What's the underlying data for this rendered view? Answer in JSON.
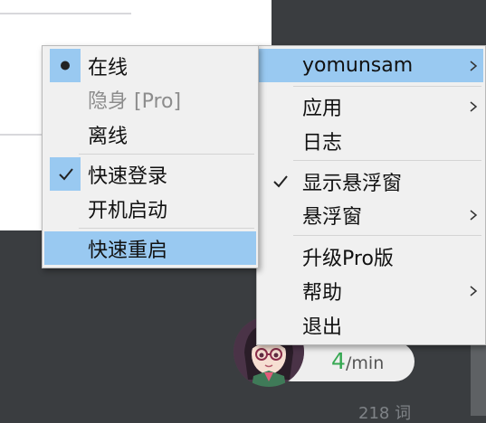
{
  "left_menu": {
    "items": [
      {
        "label": "在线",
        "mark": "bullet"
      },
      {
        "label": "隐身 [Pro]",
        "disabled": true
      },
      {
        "label": "离线"
      },
      {
        "label": "快速登录",
        "mark": "check"
      },
      {
        "label": "开机启动"
      },
      {
        "label": "快速重启",
        "highlighted": true
      }
    ]
  },
  "right_menu": {
    "items": [
      {
        "label": "yomunsam",
        "submenu": true,
        "highlighted": true
      },
      {
        "label": "应用",
        "submenu": true
      },
      {
        "label": "日志"
      },
      {
        "label": "显示悬浮窗",
        "mark": "check"
      },
      {
        "label": "悬浮窗",
        "submenu": true
      },
      {
        "label": "升级Pro版"
      },
      {
        "label": "帮助",
        "submenu": true
      },
      {
        "label": "退出"
      }
    ]
  },
  "widget": {
    "speed_value": "4",
    "speed_unit": "/min"
  },
  "background": {
    "partial_text": "218 词"
  },
  "colors": {
    "highlight": "#99c9f1",
    "menu_bg": "#f0f0f0",
    "speed_green": "#35a852"
  }
}
